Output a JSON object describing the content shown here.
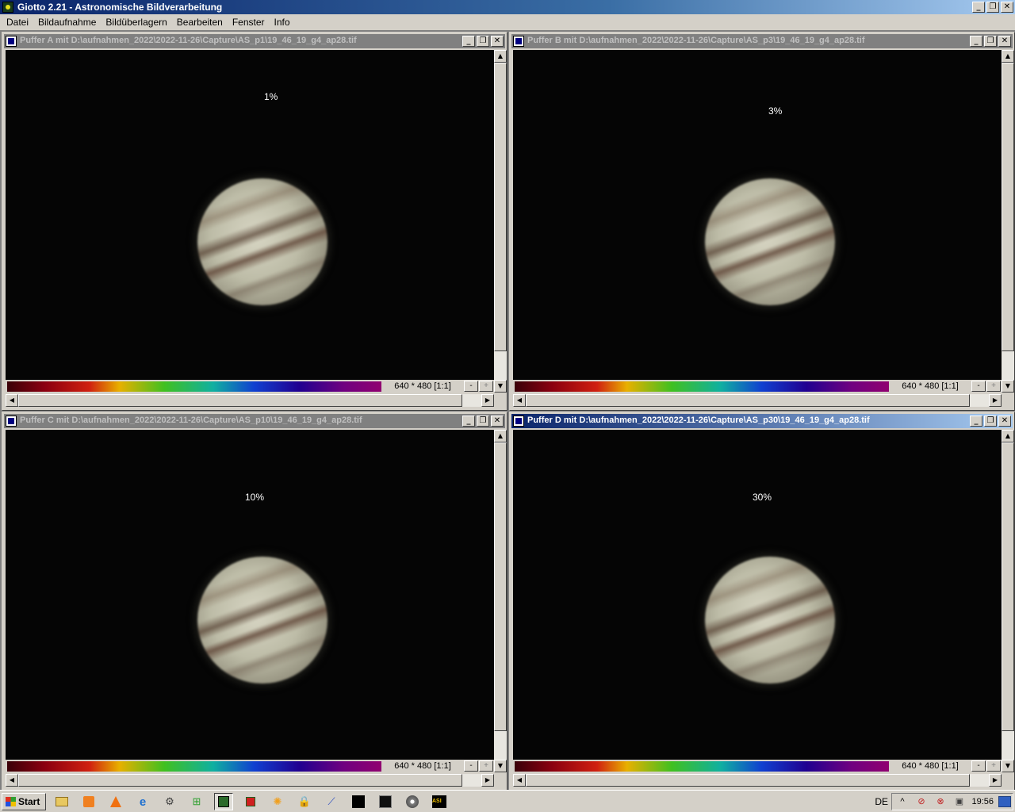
{
  "app": {
    "title": "Giotto 2.21 - Astronomische Bildverarbeitung",
    "caption_buttons": {
      "minimize": "_",
      "restore": "❐",
      "close": "✕"
    }
  },
  "menu": [
    "Datei",
    "Bildaufnahme",
    "Bildüberlagern",
    "Bearbeiten",
    "Fenster",
    "Info"
  ],
  "windows": [
    {
      "title": "Puffer A mit D:\\aufnahmen_2022\\2022-11-26\\Capture\\AS_p1\\19_46_19_g4_ap28.tif",
      "label": "1%",
      "dims": "640 * 480 [1:1]",
      "active": false
    },
    {
      "title": "Puffer B mit D:\\aufnahmen_2022\\2022-11-26\\Capture\\AS_p3\\19_46_19_g4_ap28.tif",
      "label": "3%",
      "dims": "640 * 480 [1:1]",
      "active": false
    },
    {
      "title": "Puffer C mit D:\\aufnahmen_2022\\2022-11-26\\Capture\\AS_p10\\19_46_19_g4_ap28.tif",
      "label": "10%",
      "dims": "640 * 480 [1:1]",
      "active": false
    },
    {
      "title": "Puffer D mit D:\\aufnahmen_2022\\2022-11-26\\Capture\\AS_p30\\19_46_19_g4_ap28.tif",
      "label": "30%",
      "dims": "640 * 480 [1:1]",
      "active": true
    }
  ],
  "zoom": {
    "minus": "-",
    "plus": "+"
  },
  "scroll": {
    "up": "▲",
    "down": "▼",
    "left": "◀",
    "right": "▶"
  },
  "taskbar": {
    "start": "Start",
    "language": "DE",
    "clock": "19:56",
    "tray_chevron": "^"
  }
}
